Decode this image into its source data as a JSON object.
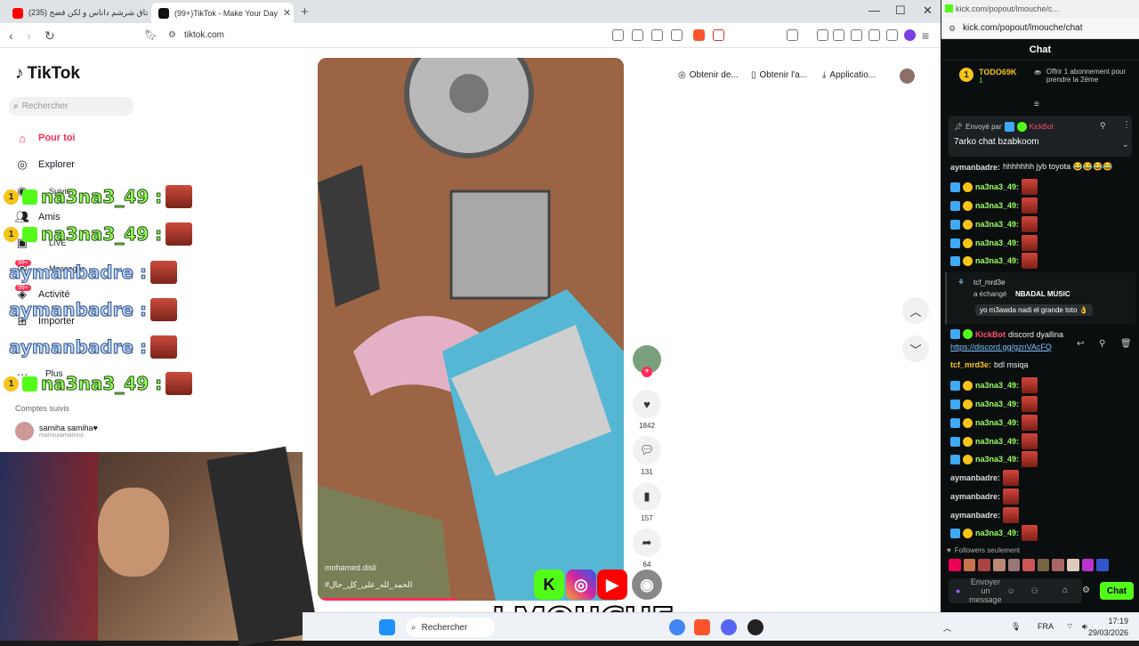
{
  "browser": {
    "tabs": [
      {
        "label": "(235) بوسحاق شرشم داناس و لكن فضح",
        "active": false
      },
      {
        "label": "(99+)TikTok - Make Your Day",
        "active": true
      }
    ],
    "url": "tiktok.com"
  },
  "tiktok": {
    "logo": "TikTok",
    "search_placeholder": "Rechercher",
    "nav": [
      {
        "label": "Pour toi",
        "active": true
      },
      {
        "label": "Explorer"
      },
      {
        "label": "Suivis"
      },
      {
        "label": "Amis"
      },
      {
        "label": "LIVE"
      },
      {
        "label": "Messages"
      },
      {
        "label": "Activité"
      },
      {
        "label": "Importer"
      },
      {
        "label": "Plus"
      }
    ],
    "badge_99": "99+",
    "followed_title": "Comptes suivis",
    "account": {
      "name": "samiha samiha♥",
      "handle": "mariouiamarioui"
    },
    "top_actions": [
      "Obtenir de...",
      "Obtenir l'a...",
      "Applicatio..."
    ],
    "video": {
      "author": "mohamed.disli",
      "tags": "#الحمد_لله_على_كل_حال"
    },
    "counts": {
      "likes": "1842",
      "comments": "131",
      "saves": "157",
      "shares": "64"
    }
  },
  "overlay": {
    "lines": [
      "na3na3_49 :",
      "na3na3_49 :",
      "aymanbadre :",
      "aymanbadre :",
      "aymanbadre :",
      "na3na3_49 :"
    ],
    "streamer": "LMOUCHE"
  },
  "taskbar": {
    "search": "Rechercher",
    "lang": "FRA",
    "time": "17:19",
    "date": "29/03/2026"
  },
  "kick": {
    "title_url": "kick.com/popout/lmouche/c...",
    "url": "kick.com/popout/lmouche/chat",
    "header": "Chat",
    "top_user": "TODO69K",
    "top_user_sub": "1",
    "sub_offer": "Offrir 1 abonnement pour prendre la 2ème",
    "pinned_by": "Envoyé par",
    "pinned_user": "KickBot",
    "pinned_text": "7arko chat bzabkoom",
    "messages": [
      {
        "user": "aymanbadre:",
        "text": "hhhhhhh jyb toyota 😂😂😂😂",
        "style": "white"
      },
      {
        "user": "na3na3_49:",
        "emote": true
      },
      {
        "user": "na3na3_49:",
        "emote": true
      },
      {
        "user": "na3na3_49:",
        "emote": true
      },
      {
        "user": "na3na3_49:",
        "emote": true
      },
      {
        "user": "na3na3_49:",
        "emote": true
      }
    ],
    "reward_user": "tcf_mrd3e",
    "reward_text": "a échangé",
    "reward_item": "NBADAL MUSIC",
    "reward_msg": "yo m3awda nadi el grande toto 👌",
    "bot_user": "KickBot",
    "bot_text": "discord dyallina",
    "bot_link": "https://discord.gg/gznVAcFQ",
    "msg2_user": "tcf_mrd3e:",
    "msg2_text": "bdl msiqa",
    "messages2": [
      {
        "user": "na3na3_49:"
      },
      {
        "user": "na3na3_49:"
      },
      {
        "user": "na3na3_49:"
      },
      {
        "user": "na3na3_49:"
      },
      {
        "user": "na3na3_49:"
      }
    ],
    "messages3": [
      {
        "user": "aymanbadre:"
      },
      {
        "user": "aymanbadre:"
      },
      {
        "user": "aymanbadre:"
      },
      {
        "user": "na3na3_49:"
      }
    ],
    "followers_only": "Followers seulement",
    "input_placeholder": "Envoyer un message",
    "chat_button": "Chat"
  }
}
